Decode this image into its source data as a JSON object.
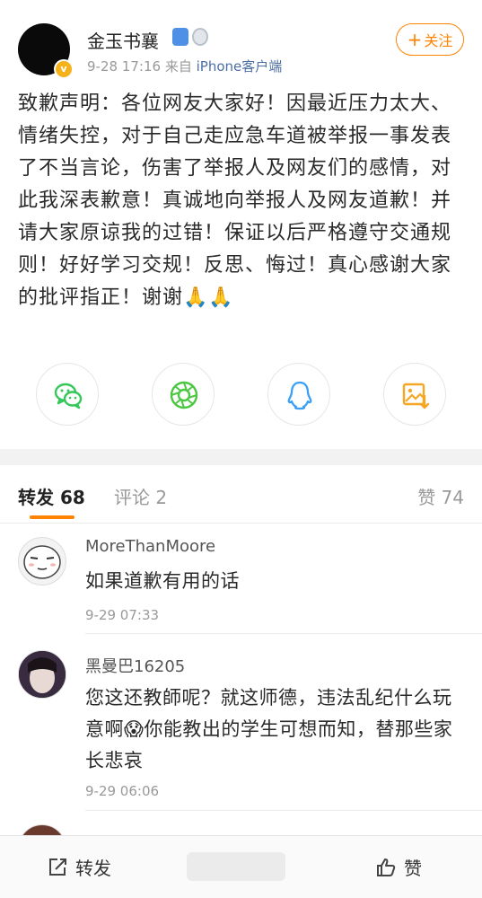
{
  "post": {
    "username": "金玉书襄",
    "time": "9-28 17:16",
    "source_prefix": "来自",
    "source": "iPhone客户端",
    "follow_label": "关注",
    "follow_plus": "+",
    "text": "致歉声明：各位网友大家好！因最近压力太大、情绪失控，对于自己走应急车道被举报一事发表了不当言论，伤害了举报人及网友们的感情，对此我深表歉意！真诚地向举报人及网友道歉！并请大家原谅我的过错！保证以后严格遵守交通规则！好好学习交规！反思、悔过！真心感谢大家的批评指正！谢谢",
    "emoji": "🙏🙏"
  },
  "share": {
    "icons": [
      "wechat-icon",
      "moments-icon",
      "qq-icon",
      "save-image-icon"
    ]
  },
  "tabs": {
    "repost": "转发 68",
    "comment": "评论 2",
    "like": "赞 74"
  },
  "comments": [
    {
      "name": "MoreThanMoore",
      "text": "如果道歉有用的话",
      "time": "9-29 07:33"
    },
    {
      "name": "黑曼巴16205",
      "text": "您这还教師呢？就这师德，违法乱纪什么玩意啊😱你能教出的学生可想而知，替那些家长悲哀",
      "time": "9-29 06:06"
    }
  ],
  "bottom_bar": {
    "repost_label": "转发",
    "like_label": "赞"
  },
  "colors": {
    "accent": "#ff8200",
    "link": "#4c6fa5"
  }
}
